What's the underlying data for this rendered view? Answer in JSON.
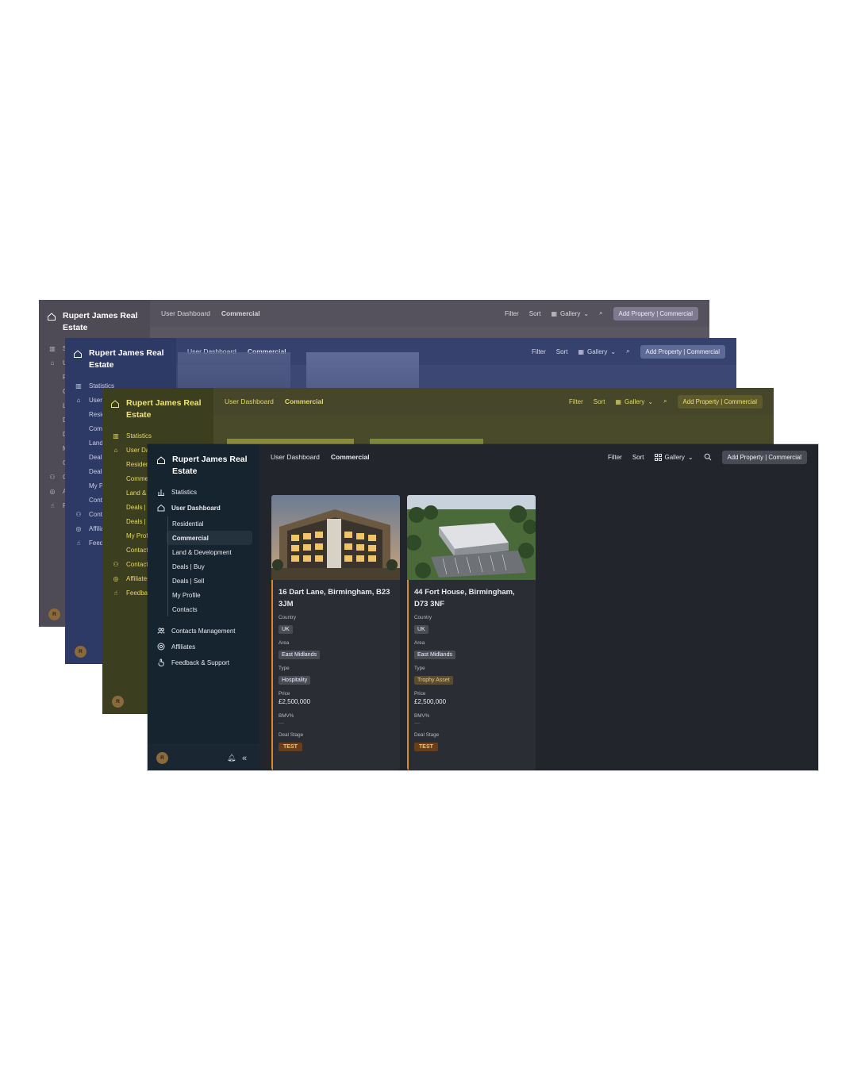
{
  "app": {
    "brand": "Rupert James Real Estate",
    "brand_line1": "Rupert James Real",
    "brand_line2": "Estate",
    "avatar_initial": "R"
  },
  "breadcrumb": {
    "root": "User Dashboard",
    "current": "Commercial"
  },
  "toolbar": {
    "filter": "Filter",
    "sort": "Sort",
    "gallery": "Gallery",
    "add_property": "Add Property | Commercial"
  },
  "nav": {
    "statistics": "Statistics",
    "user_dashboard": "User Dashboard",
    "residential": "Residential",
    "commercial": "Commercial",
    "land_development": "Land & Development",
    "deals_buy": "Deals | Buy",
    "deals_sell": "Deals | Sell",
    "my_profile": "My Profile",
    "contacts": "Contacts",
    "contacts_management": "Contacts Management",
    "affiliates": "Affiliates",
    "feedback_support": "Feedback & Support"
  },
  "fields": {
    "country": "Country",
    "area": "Area",
    "type": "Type",
    "price": "Price",
    "bmv": "BMV%",
    "deal_stage": "Deal Stage"
  },
  "properties": [
    {
      "address": "16 Dart Lane, Birmingham, B23 3JM",
      "country": "UK",
      "area": "East Midlands",
      "type": "Hospitality",
      "price": "£2,500,000",
      "bmv": "—",
      "deal_stage": "TEST"
    },
    {
      "address": "44 Fort House, Birmingham, D73 3NF",
      "country": "UK",
      "area": "East Midlands",
      "type": "Trophy Asset",
      "price": "£2,500,000",
      "bmv": "—",
      "deal_stage": "TEST"
    }
  ],
  "colors": {
    "accent": "#d98a2a",
    "sidebar": "#162430",
    "background": "#23252c"
  }
}
